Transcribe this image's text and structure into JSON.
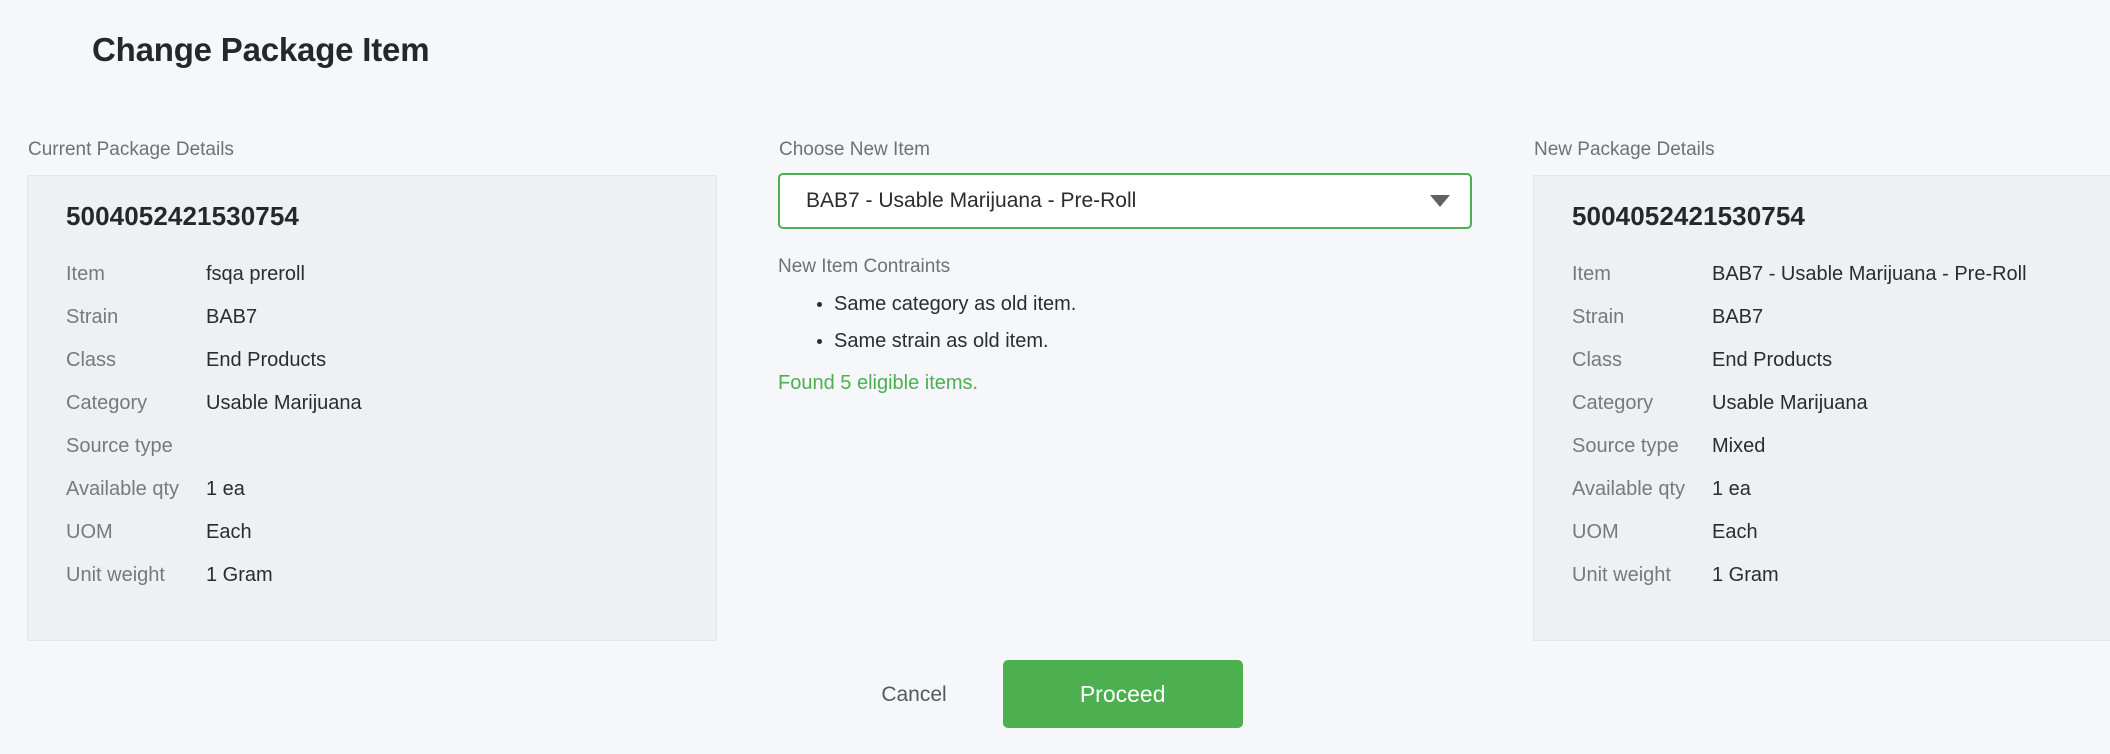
{
  "page": {
    "title": "Change Package Item"
  },
  "current_panel": {
    "heading": "Current Package Details",
    "package_code": "5004052421530754",
    "rows": [
      {
        "label": "Item",
        "value": "fsqa preroll"
      },
      {
        "label": "Strain",
        "value": "BAB7"
      },
      {
        "label": "Class",
        "value": "End Products"
      },
      {
        "label": "Category",
        "value": "Usable Marijuana"
      },
      {
        "label": "Source type",
        "value": ""
      },
      {
        "label": "Available qty",
        "value": "1 ea"
      },
      {
        "label": "UOM",
        "value": "Each"
      },
      {
        "label": "Unit weight",
        "value": "1 Gram"
      }
    ]
  },
  "chooser": {
    "heading": "Choose New Item",
    "selected_option": "BAB7 - Usable Marijuana - Pre-Roll",
    "caret_icon": "chevron-down-icon",
    "constraints_heading": "New Item Contraints",
    "constraints": [
      "Same category as old item.",
      "Same strain as old item."
    ],
    "eligible_text": "Found 5 eligible items."
  },
  "new_panel": {
    "heading": "New Package Details",
    "package_code": "5004052421530754",
    "rows": [
      {
        "label": "Item",
        "value": "BAB7 - Usable Marijuana - Pre-Roll"
      },
      {
        "label": "Strain",
        "value": "BAB7"
      },
      {
        "label": "Class",
        "value": "End Products"
      },
      {
        "label": "Category",
        "value": "Usable Marijuana"
      },
      {
        "label": "Source type",
        "value": "Mixed"
      },
      {
        "label": "Available qty",
        "value": "1 ea"
      },
      {
        "label": "UOM",
        "value": "Each"
      },
      {
        "label": "Unit weight",
        "value": "1 Gram"
      }
    ]
  },
  "footer": {
    "cancel_label": "Cancel",
    "proceed_label": "Proceed"
  },
  "colors": {
    "accent_green": "#4caf50",
    "page_background": "#f6f7fb",
    "card_background": "#eff0f3",
    "label_gray": "#77797d"
  }
}
